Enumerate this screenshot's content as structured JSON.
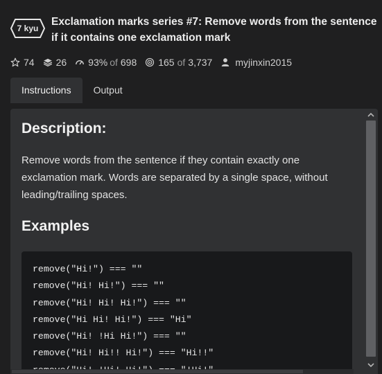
{
  "kata": {
    "rank": "7 kyu",
    "title_line1": "Exclamation marks series #7: Remove words from the sentence",
    "title_line2": "if it contains one exclamation mark"
  },
  "stats": {
    "stars": "74",
    "collections": "26",
    "satisfaction_percent": "93%",
    "satisfaction_of": "of",
    "satisfaction_total": "698",
    "completed": "165",
    "completed_of": "of",
    "completed_total": "3,737",
    "author": "myjinxin2015"
  },
  "tabs": [
    {
      "label": "Instructions",
      "active": true
    },
    {
      "label": "Output",
      "active": false
    }
  ],
  "instructions": {
    "description_heading": "Description:",
    "description_text": "Remove words from the sentence if they contain exactly one exclamation mark. Words are separated by a single space, without leading/trailing spaces.",
    "examples_heading": "Examples",
    "code_lines": [
      "remove(\"Hi!\") === \"\"",
      "remove(\"Hi! Hi!\") === \"\"",
      "remove(\"Hi! Hi! Hi!\") === \"\"",
      "remove(\"Hi Hi! Hi!\") === \"Hi\"",
      "remove(\"Hi! !Hi Hi!\") === \"\"",
      "remove(\"Hi! Hi!! Hi!\") === \"Hi!!\"",
      "remove(\"Hi! !Hi! Hi!\") === \"!Hi!\""
    ]
  },
  "colors": {
    "background": "#1f1f20",
    "panel": "#303133",
    "code_background": "#18191b",
    "text": "#e6e6e6"
  },
  "icons": {
    "stars": "star-icon",
    "collections": "stack-icon",
    "satisfaction": "gauge-icon",
    "completed": "target-icon",
    "author": "user-icon",
    "scroll_up": "chevron-up-icon",
    "scroll_down": "chevron-down-icon"
  }
}
